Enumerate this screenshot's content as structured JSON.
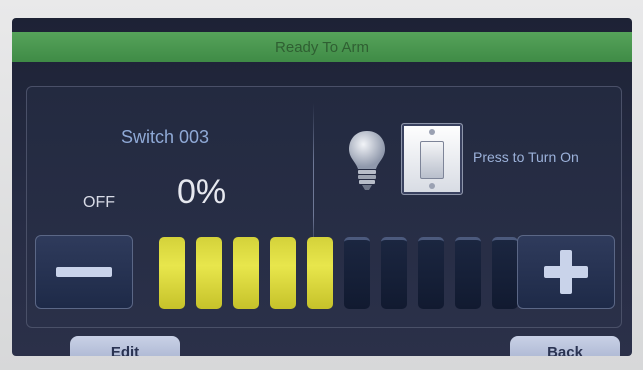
{
  "status": {
    "text": "Ready To Arm"
  },
  "device": {
    "name": "Switch 003",
    "state": "OFF",
    "level_text": "0%",
    "level_percent": 0
  },
  "toggle": {
    "label": "Press to Turn On"
  },
  "dimmer": {
    "minus_label": "—",
    "plus_label": "+",
    "bars": [
      {
        "state": "on"
      },
      {
        "state": "on"
      },
      {
        "state": "on"
      },
      {
        "state": "on"
      },
      {
        "state": "on"
      },
      {
        "state": "off"
      },
      {
        "state": "off"
      },
      {
        "state": "off"
      },
      {
        "state": "off"
      },
      {
        "state": "off"
      }
    ]
  },
  "footer": {
    "edit_label": "Edit",
    "back_label": "Back"
  },
  "colors": {
    "status_green": "#4a9a50",
    "bar_on": "#e0de42",
    "bar_off": "#142036",
    "accent_text": "#8fa9d6"
  },
  "icons": {
    "bulb": "light-bulb-icon",
    "switch": "wall-switch-icon",
    "minus": "minus-icon",
    "plus": "plus-icon"
  }
}
